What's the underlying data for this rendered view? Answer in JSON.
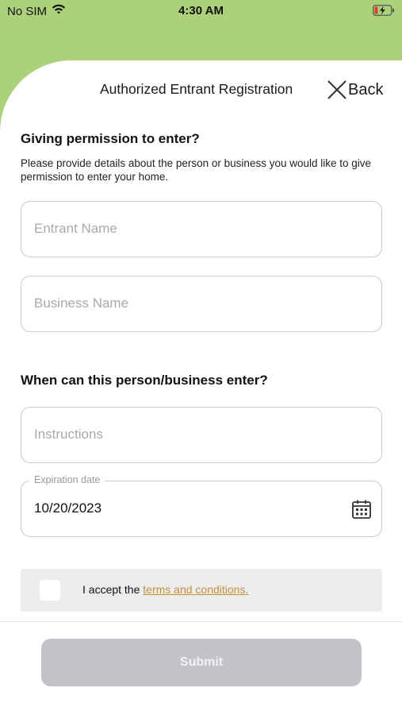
{
  "status_bar": {
    "carrier": "No SIM",
    "time": "4:30 AM",
    "wifi_icon": "wifi-icon",
    "battery_icon": "battery-charging-icon",
    "battery_color": "#e0402f"
  },
  "header": {
    "title": "Authorized Entrant Registration",
    "back_label": "Back",
    "close_icon": "close-icon"
  },
  "section1": {
    "title": "Giving permission to enter?",
    "description": "Please provide details about the person or business you would like to give permission to enter your home."
  },
  "fields": {
    "entrant_name": {
      "placeholder": "Entrant Name",
      "value": ""
    },
    "business_name": {
      "placeholder": "Business Name",
      "value": ""
    }
  },
  "section2": {
    "title": "When can this person/business enter?"
  },
  "schedule": {
    "instructions": {
      "placeholder": "Instructions",
      "value": ""
    },
    "expiration": {
      "label": "Expiration date",
      "value": "10/20/2023",
      "icon": "calendar-icon"
    }
  },
  "terms": {
    "prefix": "I accept the ",
    "link_text": "terms and conditions.",
    "checked": false
  },
  "submit": {
    "label": "Submit",
    "enabled": false
  },
  "colors": {
    "background_green": "#abd17b",
    "link": "#c4903a",
    "submit_disabled": "#c2c3c8"
  }
}
